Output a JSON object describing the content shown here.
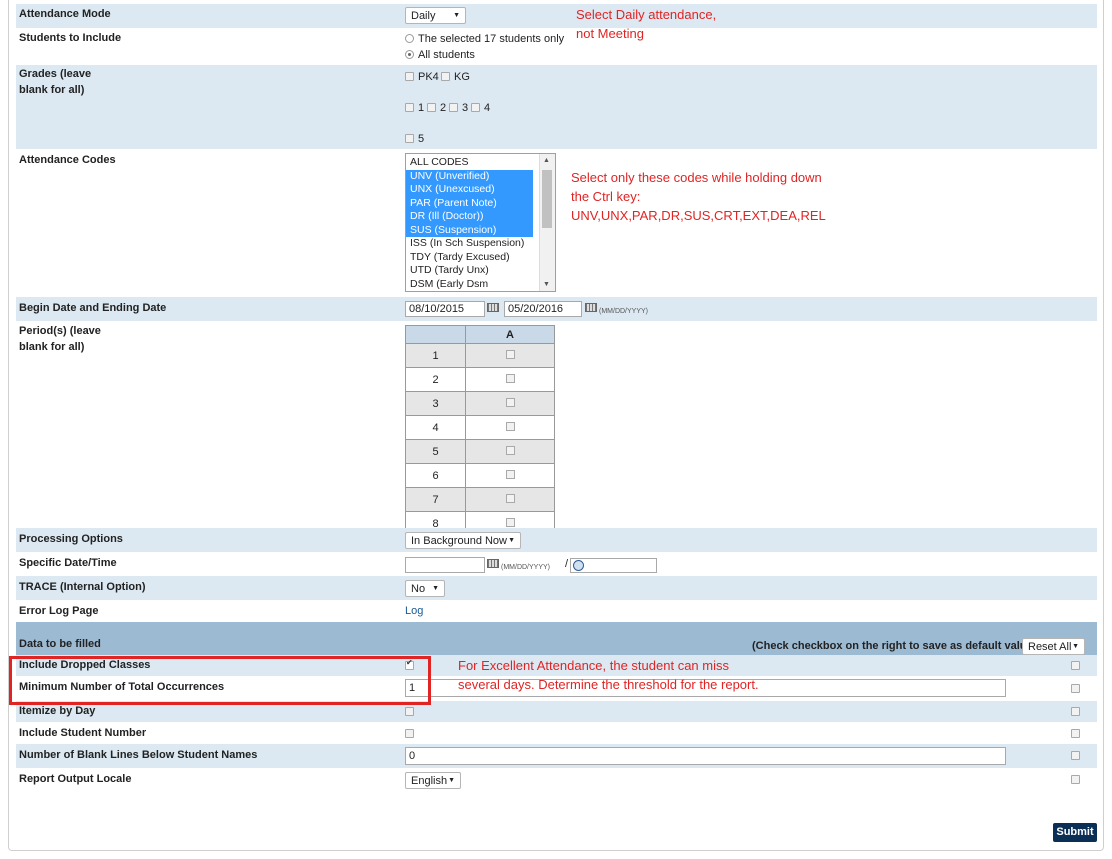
{
  "form": {
    "attendance_mode": {
      "label": "Attendance Mode",
      "value": "Daily"
    },
    "students_to_include": {
      "label": "Students to Include",
      "option1": "The selected 17 students only",
      "option2": "All students"
    },
    "grades": {
      "label_line1": "Grades (leave",
      "label_line2": "blank for all)",
      "items": [
        "PK4",
        "KG",
        "1",
        "2",
        "3",
        "4",
        "5"
      ]
    },
    "attendance_codes": {
      "label": "Attendance Codes",
      "options": [
        {
          "text": "ALL CODES",
          "selected": false
        },
        {
          "text": "UNV (Unverified)",
          "selected": true
        },
        {
          "text": "UNX (Unexcused)",
          "selected": true
        },
        {
          "text": "PAR (Parent Note)",
          "selected": true
        },
        {
          "text": "DR (Ill (Doctor))",
          "selected": true
        },
        {
          "text": "SUS (Suspension)",
          "selected": true
        },
        {
          "text": "ISS (In Sch Suspension)",
          "selected": false
        },
        {
          "text": "TDY (Tardy Excused)",
          "selected": false
        },
        {
          "text": "UTD (Tardy Unx)",
          "selected": false
        },
        {
          "text": "DSM (Early Dsm Excused)",
          "selected": false
        }
      ]
    },
    "dates": {
      "label": "Begin Date and Ending Date",
      "begin": "08/10/2015",
      "end": "05/20/2016",
      "format": "(MM/DD/YYYY)"
    },
    "periods": {
      "label_line1": "Period(s) (leave",
      "label_line2": "blank for all)",
      "column": "A",
      "rows": [
        "1",
        "2",
        "3",
        "4",
        "5",
        "6",
        "7",
        "8"
      ]
    },
    "processing_options": {
      "label": "Processing Options",
      "value": "In Background Now"
    },
    "specific_datetime": {
      "label": "Specific Date/Time",
      "format": "(MM/DD/YYYY)",
      "sep": "/"
    },
    "trace": {
      "label": "TRACE (Internal Option)",
      "value": "No"
    },
    "error_log": {
      "label": "Error Log Page",
      "link": "Log"
    }
  },
  "data_section": {
    "title": "Data to be filled",
    "note": "(Check checkbox on the right to save as default value)",
    "reset": "Reset All",
    "rows": [
      {
        "label": "Include Dropped Classes"
      },
      {
        "label": "Minimum Number of Total Occurrences",
        "value": "1"
      },
      {
        "label": "Itemize by Day"
      },
      {
        "label": "Include Student Number"
      },
      {
        "label": "Number of Blank Lines Below Student Names",
        "value": "0"
      },
      {
        "label": "Report Output Locale",
        "value": "English"
      }
    ]
  },
  "annotations": {
    "daily": [
      "Select Daily attendance,",
      "not Meeting"
    ],
    "codes": [
      "Select only these codes while holding down",
      "the Ctrl key:",
      "UNV,UNX,PAR,DR,SUS,CRT,EXT,DEA,REL"
    ],
    "excellent": [
      "For Excellent Attendance, the student can miss",
      "several days. Determine the threshold for the report."
    ]
  },
  "submit_label": "Submit",
  "colors": {
    "row_blue": "#dce9f2",
    "header_blue": "#9dbad3",
    "annotation_red": "#e02424",
    "submit_navy": "#0b2e55",
    "highlight": "#3399ff"
  }
}
